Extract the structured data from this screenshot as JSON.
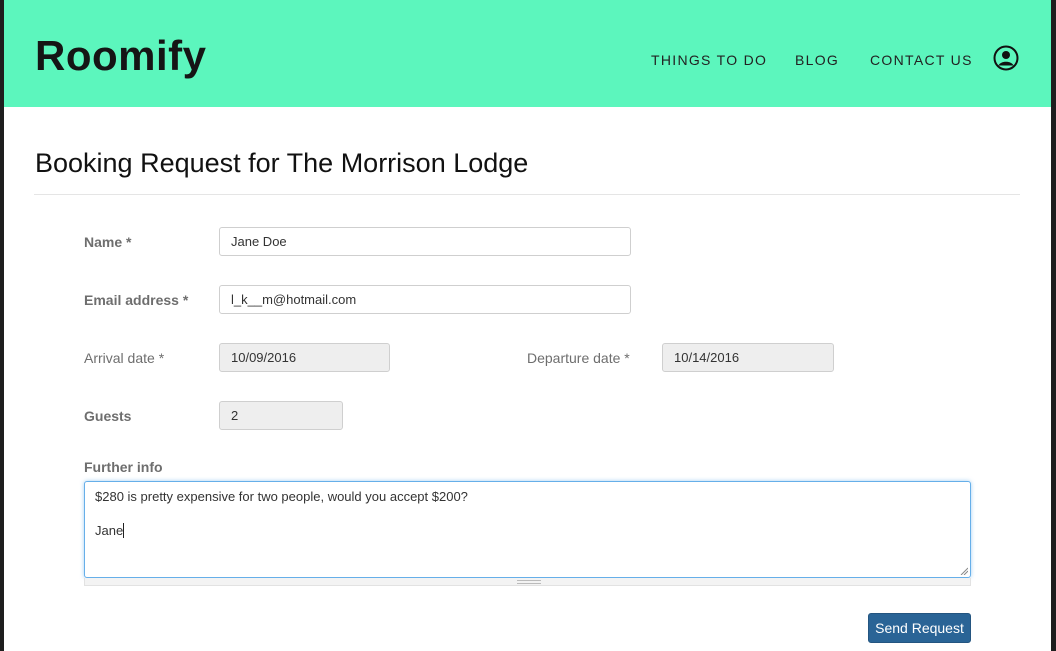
{
  "app": {
    "logo": "Roomify"
  },
  "nav": {
    "items": [
      {
        "label": "THINGS TO DO"
      },
      {
        "label": "BLOG"
      },
      {
        "label": "CONTACT US"
      }
    ],
    "user_icon": "user-circle-icon"
  },
  "page": {
    "title": "Booking Request for The Morrison Lodge"
  },
  "form": {
    "name": {
      "label": "Name *",
      "value": "Jane Doe"
    },
    "email": {
      "label": "Email address *",
      "value": "l_k__m@hotmail.com"
    },
    "arrival": {
      "label": "Arrival date *",
      "value": "10/09/2016"
    },
    "departure": {
      "label": "Departure date *",
      "value": "10/14/2016"
    },
    "guests": {
      "label": "Guests",
      "value": "2"
    },
    "further_info": {
      "label": "Further info",
      "line1": "$280 is pretty expensive for two people, would you accept $200?",
      "line2": "",
      "line3": "Jane"
    },
    "submit_label": "Send Request"
  },
  "colors": {
    "header_bg": "#5cf6bd",
    "button_bg": "#2a6496",
    "focus_border": "#66afe9"
  }
}
